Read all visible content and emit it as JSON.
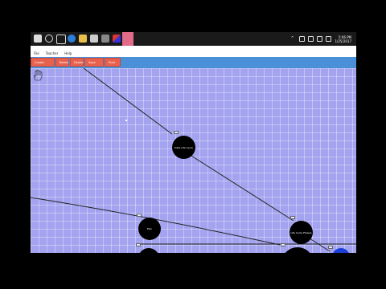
{
  "menu": {
    "file": "File",
    "teacher": "Teacher",
    "help": "Help"
  },
  "toolbar": {
    "buttons": [
      "Create Activity",
      "Relate",
      "Delete",
      "Save Activity",
      "Print"
    ]
  },
  "clock": {
    "time": "5:06 PM",
    "date": "1/25/2017"
  },
  "nodes": {
    "n1": "Data Life Cycle",
    "n2": "Life Cycle Phases",
    "n3": "Plan"
  },
  "colors": {
    "canvas": "#a3a3f0",
    "toolbar": "#4a90d9",
    "button": "#e8614e"
  }
}
